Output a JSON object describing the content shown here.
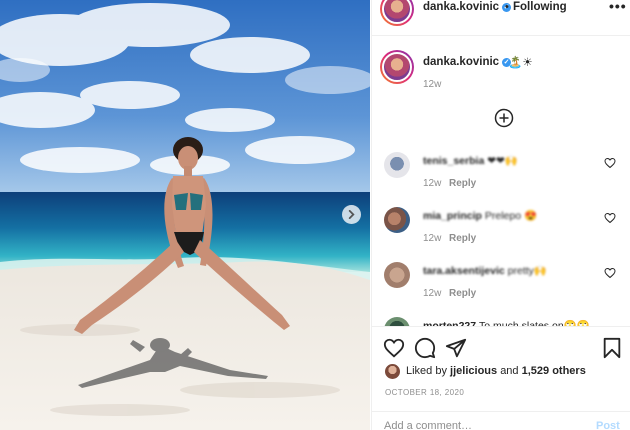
{
  "post": {
    "photo_alt": "Photo",
    "username": "danka.kovinic",
    "verified_mark": "✓",
    "dot": "•",
    "following_label": "Following",
    "more_label": "•••",
    "caption_text": "🏝️☀",
    "caption_time": "12w",
    "comments": [
      {
        "user": "tenis_serbia",
        "text": "❤❤🙌",
        "time": "12w",
        "reply": "Reply"
      },
      {
        "user": "mia_princip",
        "text": "Prelepo 😍",
        "time": "12w",
        "reply": "Reply"
      },
      {
        "user": "tara.aksentijevic",
        "text": "pretty🙌",
        "time": "12w",
        "reply": "Reply"
      },
      {
        "user": "morten227",
        "text": "To much slates on🙄🙄",
        "time": "",
        "reply": ""
      }
    ],
    "likes_prefix": "Liked by",
    "likes_user": "jjelicious",
    "likes_and": "and",
    "likes_count": "1,529 others",
    "date": "OCTOBER 18, 2020",
    "add_comment_placeholder": "Add a comment…",
    "post_label": "Post"
  },
  "icons": {
    "next": "chevron-right-icon",
    "load_more": "plus-circle-icon",
    "like": "heart-icon",
    "comment": "comment-icon",
    "share": "paper-plane-icon",
    "save": "bookmark-icon"
  },
  "colors": {
    "link_blue": "#3897f0",
    "post_disabled": "#b3dbff",
    "meta_gray": "#8e8e8e"
  }
}
